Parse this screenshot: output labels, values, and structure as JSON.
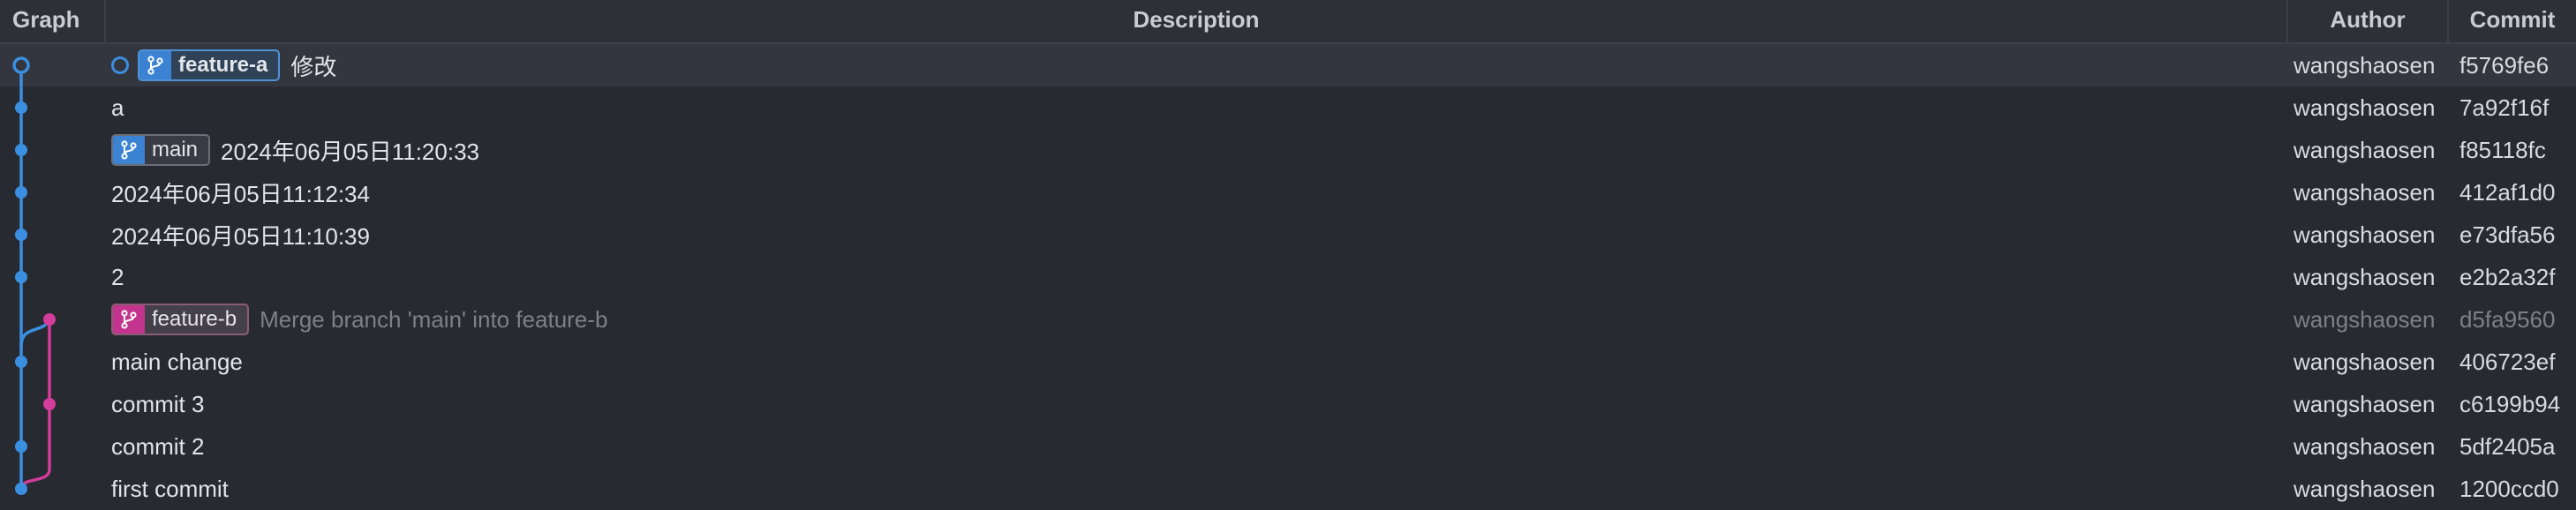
{
  "header": {
    "graph": "Graph",
    "description": "Description",
    "author": "Author",
    "commit": "Commit"
  },
  "colors": {
    "main_branch": "#3b8fe0",
    "feature_b_branch": "#d23c9a"
  },
  "commits": [
    {
      "message": "修改",
      "author": "wangshaosen",
      "hash": "f5769fe6",
      "branch_label": "feature-a",
      "badge_style": "blue",
      "lane": 0,
      "selected": true,
      "uncommitted_marker": true,
      "dim": false
    },
    {
      "message": "a",
      "author": "wangshaosen",
      "hash": "7a92f16f",
      "branch_label": "",
      "lane": 0,
      "dim": false
    },
    {
      "message": "2024年06月05日11:20:33",
      "author": "wangshaosen",
      "hash": "f85118fc",
      "branch_label": "main",
      "badge_style": "grey",
      "lane": 0,
      "dim": false
    },
    {
      "message": "2024年06月05日11:12:34",
      "author": "wangshaosen",
      "hash": "412af1d0",
      "branch_label": "",
      "lane": 0,
      "dim": false
    },
    {
      "message": "2024年06月05日11:10:39",
      "author": "wangshaosen",
      "hash": "e73dfa56",
      "branch_label": "",
      "lane": 0,
      "dim": false
    },
    {
      "message": "2",
      "author": "wangshaosen",
      "hash": "e2b2a32f",
      "branch_label": "",
      "lane": 0,
      "dim": false
    },
    {
      "message": "Merge branch 'main' into feature-b",
      "author": "wangshaosen",
      "hash": "d5fa9560",
      "branch_label": "feature-b",
      "badge_style": "pink",
      "lane": 1,
      "dim": true
    },
    {
      "message": "main change",
      "author": "wangshaosen",
      "hash": "406723ef",
      "branch_label": "",
      "lane": 0,
      "dim": false
    },
    {
      "message": "commit 3",
      "author": "wangshaosen",
      "hash": "c6199b94",
      "branch_label": "",
      "lane": 1,
      "dim": false
    },
    {
      "message": "commit 2",
      "author": "wangshaosen",
      "hash": "5df2405a",
      "branch_label": "",
      "lane": 0,
      "dim": false
    },
    {
      "message": "first commit",
      "author": "wangshaosen",
      "hash": "1200ccd0",
      "branch_label": "",
      "lane": 0,
      "dim": false
    }
  ]
}
